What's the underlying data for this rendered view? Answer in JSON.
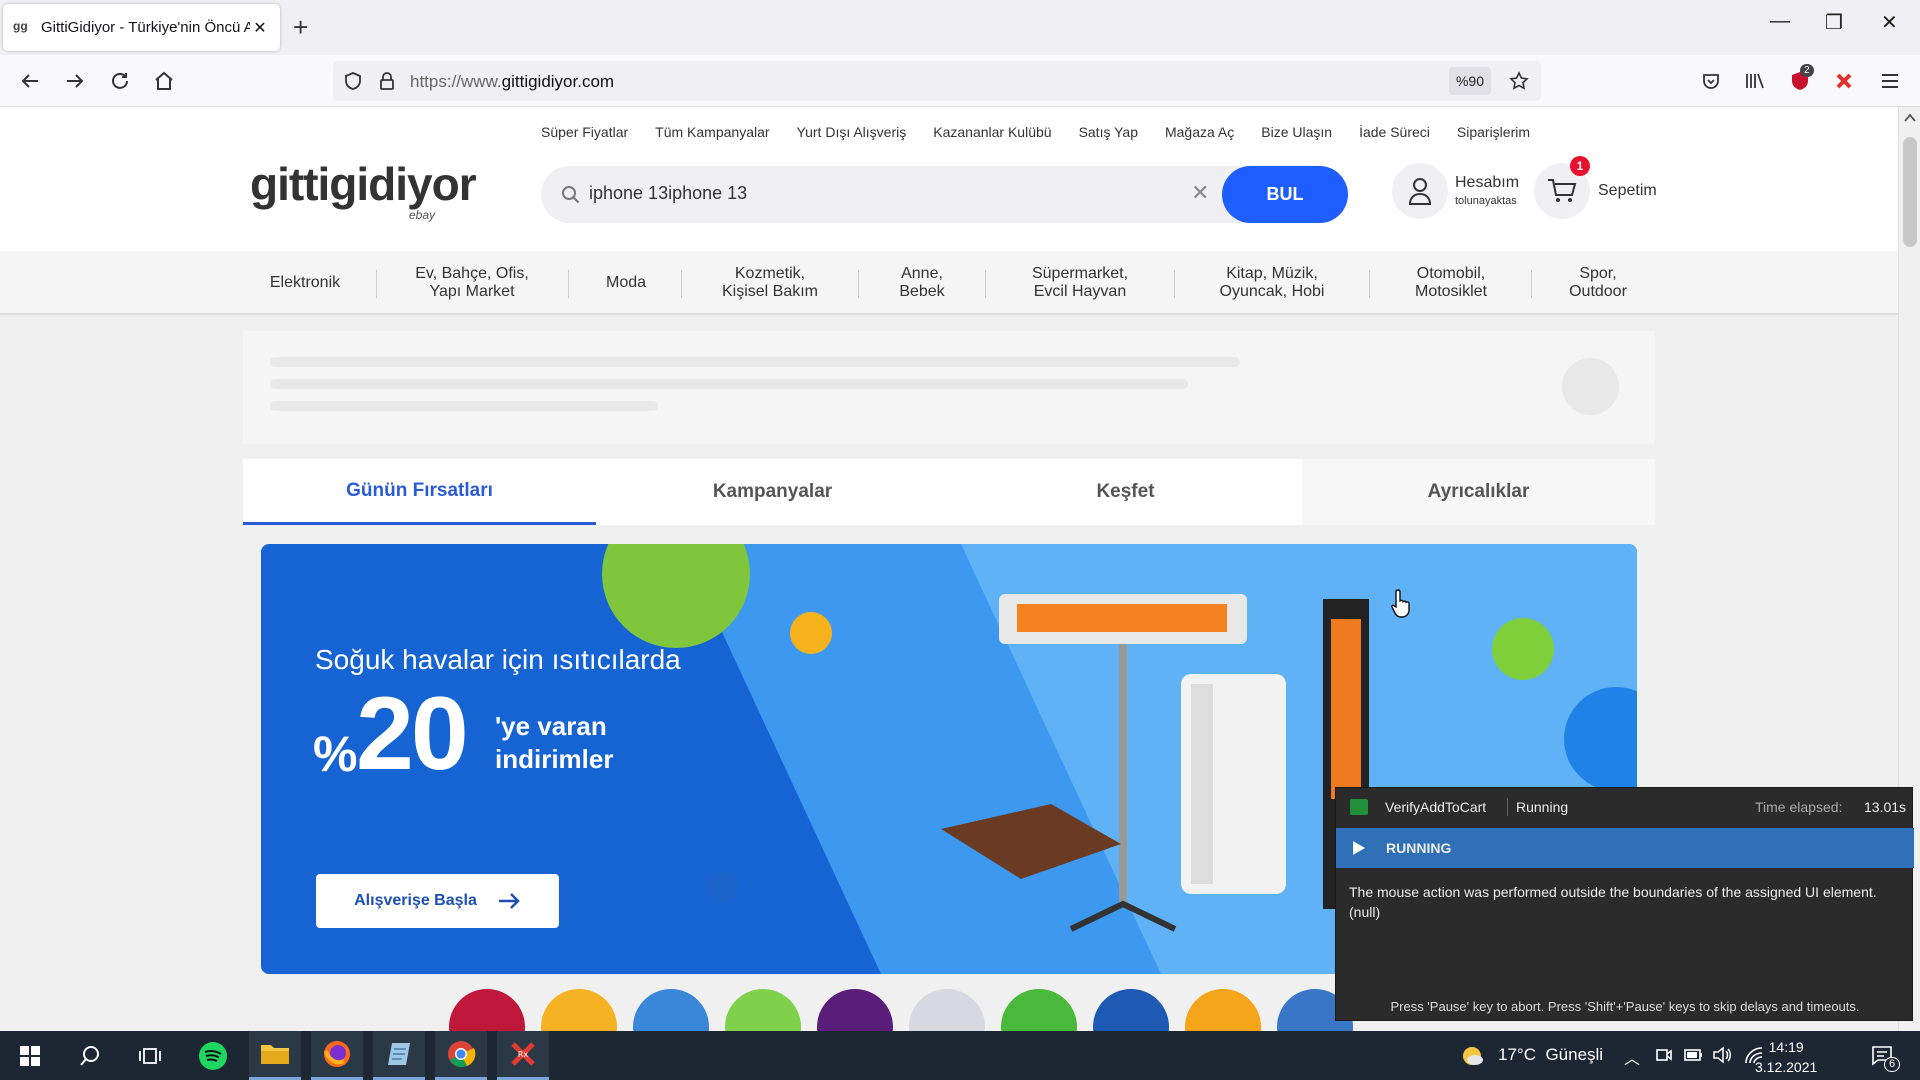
{
  "browser": {
    "tab_title": "GittiGidiyor - Türkiye'nin Öncü A",
    "favicon": "gg-favicon",
    "url_prefix": "https://www.",
    "url_domain": "gittigidiyor.com",
    "zoom": "%90",
    "extension_badge": "2"
  },
  "site": {
    "top_links": [
      "Süper Fiyatlar",
      "Tüm Kampanyalar",
      "Yurt Dışı Alışveriş",
      "Kazananlar Kulübü",
      "Satış Yap",
      "Mağaza Aç",
      "Bize Ulaşın",
      "İade Süreci",
      "Siparişlerim"
    ],
    "logo": "gittigidiyor",
    "logo_sub": "ebay",
    "search_value": "iphone 13iphone 13",
    "search_button": "BUL",
    "account_title": "Hesabım",
    "account_user": "tolunayaktas",
    "cart_label": "Sepetim",
    "cart_count": "1",
    "categories": [
      {
        "l1": "Elektronik",
        "l2": ""
      },
      {
        "l1": "Ev, Bahçe, Ofis,",
        "l2": "Yapı Market"
      },
      {
        "l1": "Moda",
        "l2": ""
      },
      {
        "l1": "Kozmetik,",
        "l2": "Kişisel Bakım"
      },
      {
        "l1": "Anne,",
        "l2": "Bebek"
      },
      {
        "l1": "Süpermarket,",
        "l2": "Evcil Hayvan"
      },
      {
        "l1": "Kitap, Müzik,",
        "l2": "Oyuncak, Hobi"
      },
      {
        "l1": "Otomobil,",
        "l2": "Motosiklet"
      },
      {
        "l1": "Spor,",
        "l2": "Outdoor"
      }
    ],
    "page_tabs": [
      "Günün Fırsatları",
      "Kampanyalar",
      "Keşfet",
      "Ayrıcalıklar"
    ],
    "banner": {
      "line1": "Soğuk havalar için ısıtıcılarda",
      "percent_sign": "%",
      "number": "20",
      "line2": "'ye varan",
      "line3": "indirimler",
      "button": "Alışverişe Başla"
    }
  },
  "runner": {
    "name": "VerifyAddToCart",
    "state": "Running",
    "elapsed_label": "Time elapsed:",
    "elapsed": "13.01s",
    "bar_label": "RUNNING",
    "message": "The mouse action was performed outside the boundaries of the assigned UI element.(null)",
    "footer": "Press 'Pause' key to abort. Press 'Shift'+'Pause' keys to skip delays and timeouts."
  },
  "taskbar": {
    "temperature": "17°C",
    "weather": "Güneşli",
    "time": "14:19",
    "date": "3.12.2021",
    "notif_count": "6"
  },
  "colors": {
    "accent": "#1e5eff",
    "tab_active": "#2a5bd7",
    "banner_bg": "#1664d3",
    "cart_badge": "#e8112d",
    "runner_bar": "#2f6fb6"
  }
}
